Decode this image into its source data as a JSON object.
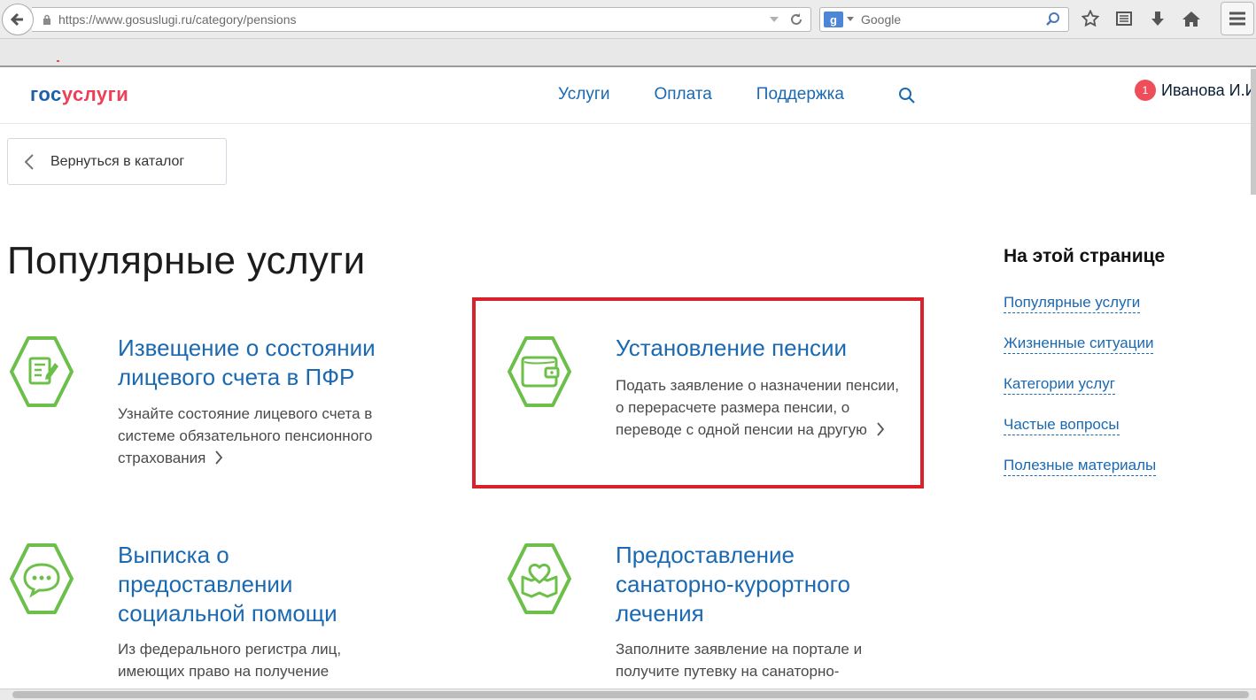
{
  "browser": {
    "url": "https://www.gosuslugi.ru/category/pensions",
    "search_placeholder": "Google",
    "search_engine_icon": "g-search-engine-icon"
  },
  "header": {
    "logo_part1": "гос",
    "logo_part2": "услуги",
    "nav": [
      "Услуги",
      "Оплата",
      "Поддержка"
    ],
    "notification_count": "1",
    "user_name": "Иванова И.И."
  },
  "back_button": "Вернуться в каталог",
  "page_title": "Популярные услуги",
  "services": [
    {
      "title": "Извещение о состоянии лицевого счета в ПФР",
      "desc": "Узнайте состояние лицевого счета в системе обязательного пенсионного страхования",
      "icon": "document-edit-icon"
    },
    {
      "title": "Установление пенсии",
      "desc": "Подать заявление о назначении пенсии, о перерасчете размера пенсии, о переводе с одной пенсии на другую",
      "icon": "wallet-icon"
    },
    {
      "title": "Выписка о предоставлении социальной помощи",
      "desc": "Из федерального регистра лиц, имеющих право на получение",
      "icon": "chat-bubble-icon"
    },
    {
      "title": "Предоставление санаторно-курортного лечения",
      "desc": "Заполните заявление на портале и получите путевку на санаторно-",
      "icon": "heart-map-icon"
    }
  ],
  "toc": {
    "title": "На этой странице",
    "links": [
      "Популярные услуги",
      "Жизненные ситуации",
      "Категории услуг",
      "Частые вопросы",
      "Полезные материалы"
    ]
  },
  "colors": {
    "link": "#1b69b1",
    "icon_green": "#6cc04a",
    "highlight_red": "#d9212c",
    "logo_red": "#ee3f58"
  }
}
